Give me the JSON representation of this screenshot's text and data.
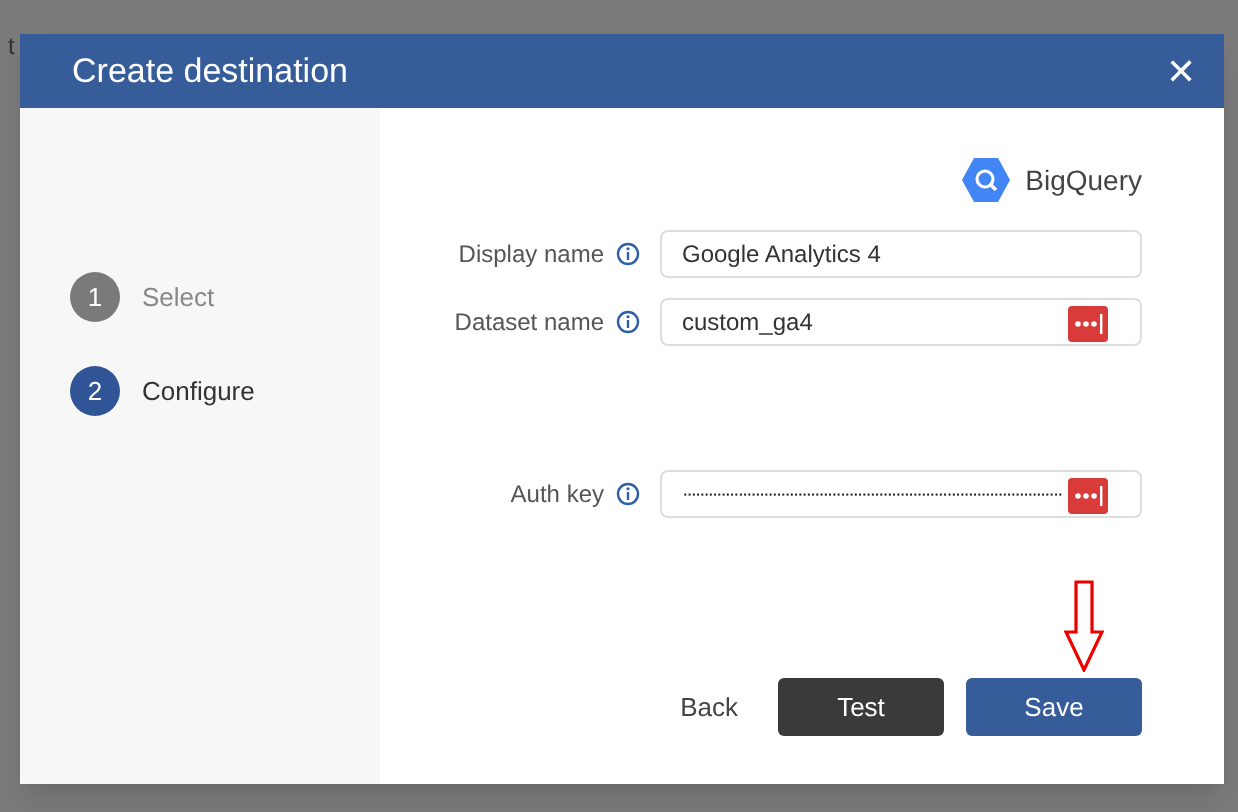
{
  "background_text": "t",
  "dialog": {
    "title": "Create destination",
    "close": "✕"
  },
  "steps": [
    {
      "number": "1",
      "label": "Select",
      "selected": false
    },
    {
      "number": "2",
      "label": "Configure",
      "selected": true
    }
  ],
  "destination": {
    "name": "BigQuery"
  },
  "fields": [
    {
      "label": "Display name",
      "value": "Google Analytics 4",
      "kind": "text",
      "password_manager": false
    },
    {
      "label": "Dataset name",
      "value": "custom_ga4",
      "kind": "text",
      "password_manager": true
    },
    {
      "label": "Auth key",
      "value": "·························································································",
      "kind": "secret",
      "password_manager": true
    }
  ],
  "buttons": [
    {
      "label": "Back",
      "kind": "link"
    },
    {
      "label": "Test",
      "kind": "dark"
    },
    {
      "label": "Save",
      "kind": "primary"
    }
  ]
}
